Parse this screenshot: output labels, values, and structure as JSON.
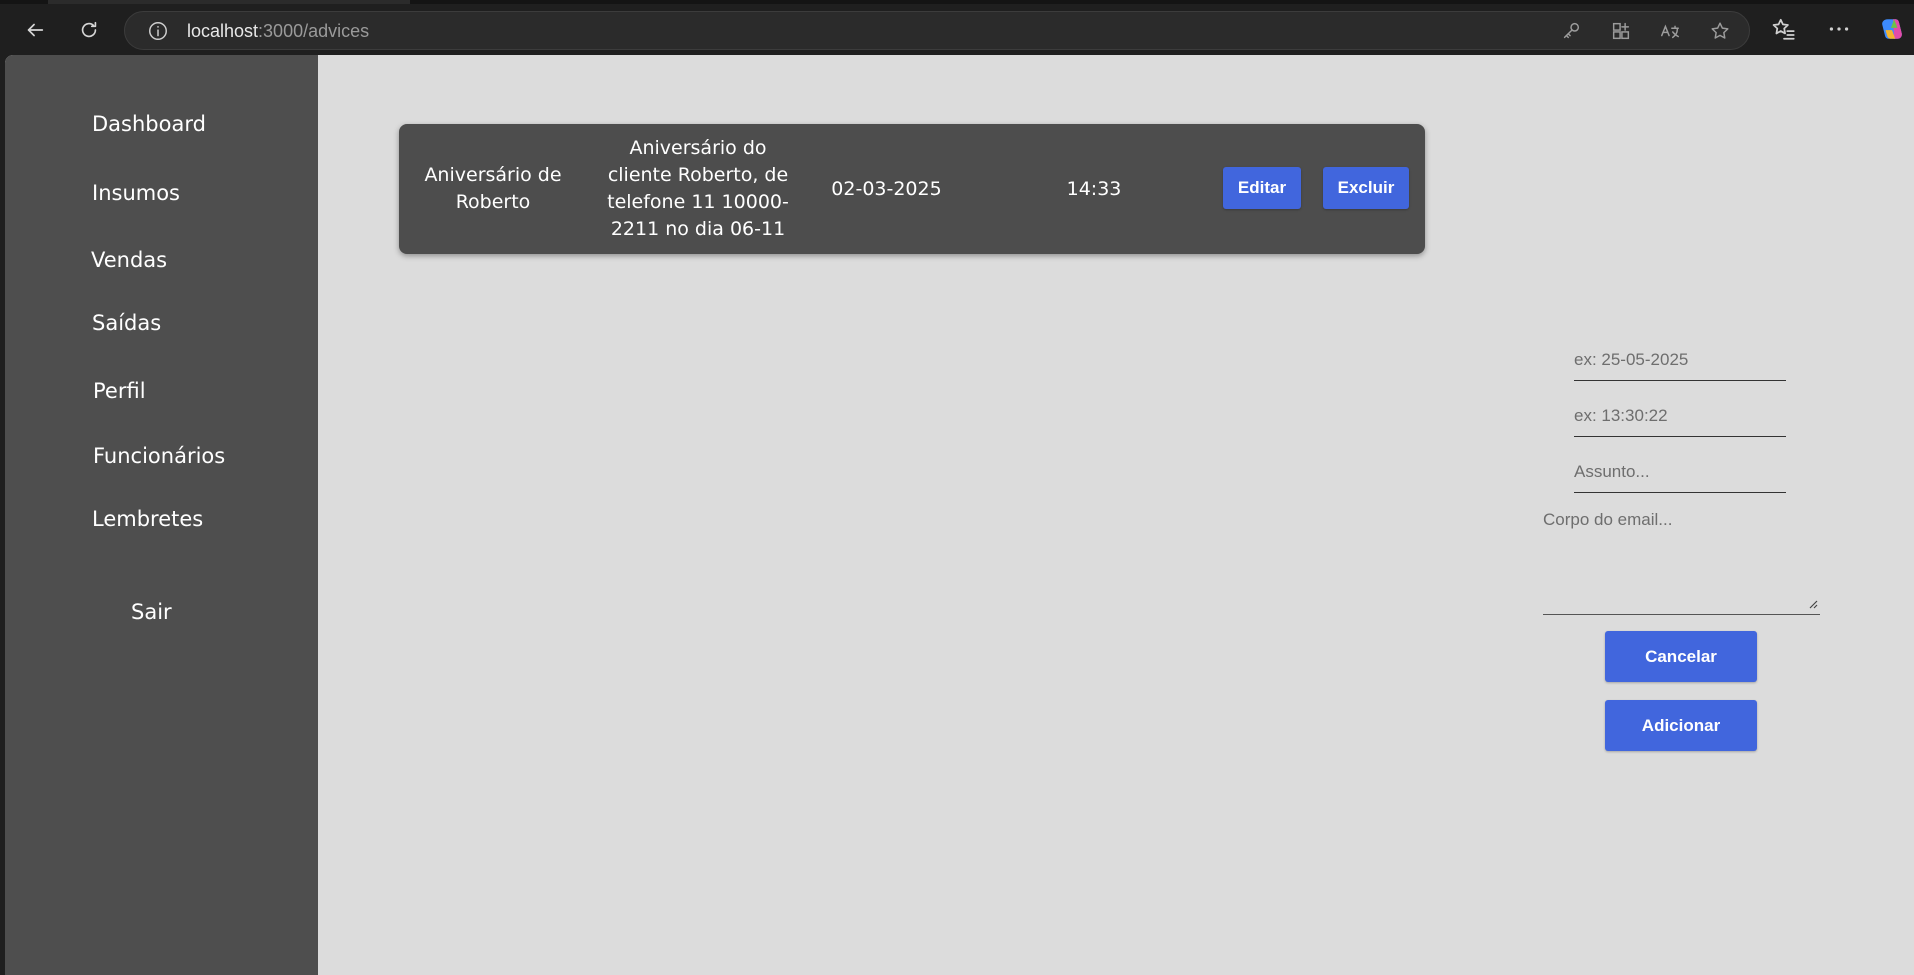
{
  "browser": {
    "url_host": "localhost",
    "url_path": ":3000/advices",
    "icons": [
      "back-arrow-icon",
      "refresh-icon",
      "info-icon",
      "key-icon",
      "apps-icon",
      "read-aloud-icon",
      "star-icon",
      "favorites-icon",
      "more-icon",
      "copilot-icon"
    ]
  },
  "sidebar": {
    "items": [
      {
        "label": "Dashboard"
      },
      {
        "label": "Insumos"
      },
      {
        "label": "Vendas"
      },
      {
        "label": "Saídas"
      },
      {
        "label": "Perfil"
      },
      {
        "label": "Funcionários"
      },
      {
        "label": "Lembretes"
      }
    ],
    "logout_label": "Sair"
  },
  "reminders": [
    {
      "title": "Aniversário de Roberto",
      "body": "Aniversário do cliente Roberto, de telefone 11 10000-2211 no dia 06-11",
      "date": "02-03-2025",
      "time": "14:33",
      "edit_label": "Editar",
      "delete_label": "Excluir"
    }
  ],
  "form": {
    "date_placeholder": "ex: 25-05-2025",
    "time_placeholder": "ex: 13:30:22",
    "subject_placeholder": "Assunto...",
    "body_placeholder": "Corpo do email...",
    "cancel_label": "Cancelar",
    "add_label": "Adicionar"
  },
  "colors": {
    "sidebar_bg": "#4e4e4e",
    "content_bg": "#dcdcdc",
    "card_bg": "#4d4d4d",
    "accent_button": "#4166dd"
  }
}
